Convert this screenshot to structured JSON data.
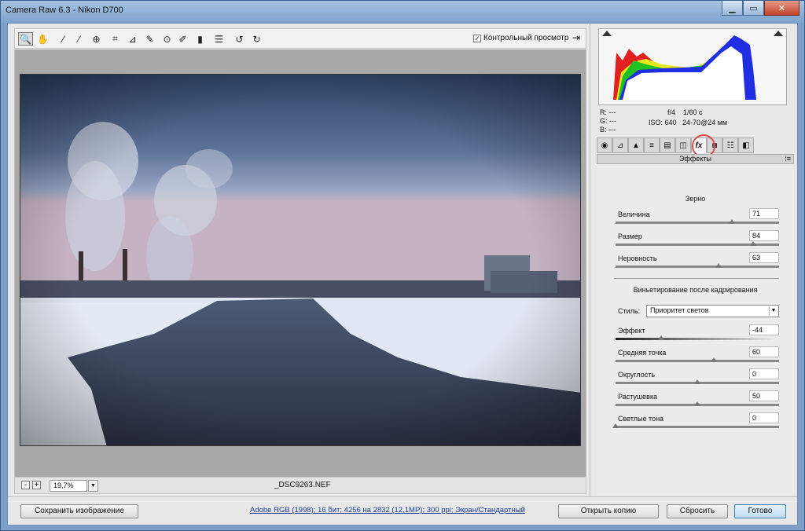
{
  "window": {
    "title": "Camera Raw 6.3  -  Nikon D700",
    "controls": {
      "minimize": "▁",
      "maximize": "▭",
      "close": "✕"
    }
  },
  "toolbar": {
    "tools": [
      "zoom-icon",
      "hand-icon",
      "white-balance-icon",
      "color-sampler-icon",
      "target-adjust-icon",
      "crop-icon",
      "straighten-icon",
      "spot-removal-icon",
      "red-eye-icon",
      "adjustment-brush-icon",
      "graduated-filter-icon",
      "preferences-icon",
      "rotate-ccw-icon",
      "rotate-cw-icon"
    ],
    "preview_label": "Контрольный просмотр",
    "preview_checked": true
  },
  "status": {
    "zoom_minus": "-",
    "zoom_plus": "+",
    "zoom_value": "19,7%",
    "zoom_dropdown": "▼",
    "filename": "_DSC9263.NEF"
  },
  "info": {
    "r_label": "R:",
    "r_value": "---",
    "g_label": "G:",
    "g_value": "---",
    "b_label": "B:",
    "b_value": "---",
    "aperture": "f/4",
    "shutter": "1/60 с",
    "iso": "ISO: 640",
    "lens": "24-70@24 мм"
  },
  "tabs": [
    {
      "icon": "◉",
      "name": "basic"
    },
    {
      "icon": "⊿",
      "name": "tone-curve"
    },
    {
      "icon": "▲",
      "name": "detail"
    },
    {
      "icon": "≡",
      "name": "hsl"
    },
    {
      "icon": "▤",
      "name": "split-toning"
    },
    {
      "icon": "◫",
      "name": "lens-corrections"
    },
    {
      "icon": "fx",
      "name": "effects"
    },
    {
      "icon": "◙",
      "name": "camera-calibration"
    },
    {
      "icon": "☷",
      "name": "presets"
    },
    {
      "icon": "◧",
      "name": "snapshots"
    }
  ],
  "panel": {
    "title": "Эффекты",
    "menu": "⁞≡",
    "grain_title": "Зерно",
    "grain": [
      {
        "label": "Величина",
        "value": "71",
        "level": 0.71
      },
      {
        "label": "Размер",
        "value": "84",
        "level": 0.84
      },
      {
        "label": "Неровность",
        "value": "63",
        "level": 0.63
      }
    ],
    "vignette_title": "Виньетирование после кадрирования",
    "style_label": "Стиль:",
    "style_value": "Приоритет светов",
    "vignette": [
      {
        "label": "Эффект",
        "value": "-44",
        "level": 0.28
      },
      {
        "label": "Средняя точка",
        "value": "60",
        "level": 0.6
      },
      {
        "label": "Округлость",
        "value": "0",
        "level": 0.5
      },
      {
        "label": "Растушевка",
        "value": "50",
        "level": 0.5
      },
      {
        "label": "Светлые тона",
        "value": "0",
        "level": 0.0
      }
    ]
  },
  "bottom": {
    "save_label": "Сохранить изображение",
    "workflow": "Adobe RGB (1998); 16 бит; 4256 на 2832 (12,1MP); 300 ppi; Экран/Стандартный",
    "open_copy_label": "Открыть копию",
    "reset_label": "Сбросить",
    "done_label": "Готово"
  }
}
